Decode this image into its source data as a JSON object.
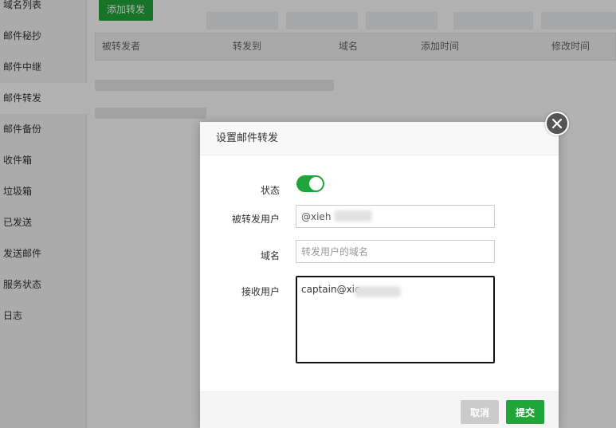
{
  "sidebar": {
    "items": [
      {
        "label": "域名列表"
      },
      {
        "label": "邮件秘抄"
      },
      {
        "label": "邮件中继"
      },
      {
        "label": "邮件转发",
        "active": true
      },
      {
        "label": "邮件备份"
      },
      {
        "label": "收件箱"
      },
      {
        "label": "垃圾箱"
      },
      {
        "label": "已发送"
      },
      {
        "label": "发送邮件"
      },
      {
        "label": "服务状态"
      },
      {
        "label": "日志"
      }
    ]
  },
  "main": {
    "add_button_label": "添加转发",
    "table": {
      "headers": [
        "被转发者",
        "转发到",
        "域名",
        "添加时间",
        "修改时间"
      ]
    }
  },
  "dialog": {
    "title": "设置邮件转发",
    "fields": {
      "status_label": "状态",
      "status_on": true,
      "forwarded_user_label": "被转发用户",
      "forwarded_user_value": "@xieh",
      "domain_label": "域名",
      "domain_placeholder": "转发用户的域名",
      "receiver_label": "接收用户",
      "receiver_value": "captain@xie"
    },
    "cancel_label": "取消",
    "submit_label": "提交"
  },
  "colors": {
    "accent": "#20a53a",
    "cancel": "#cbcbcb"
  }
}
